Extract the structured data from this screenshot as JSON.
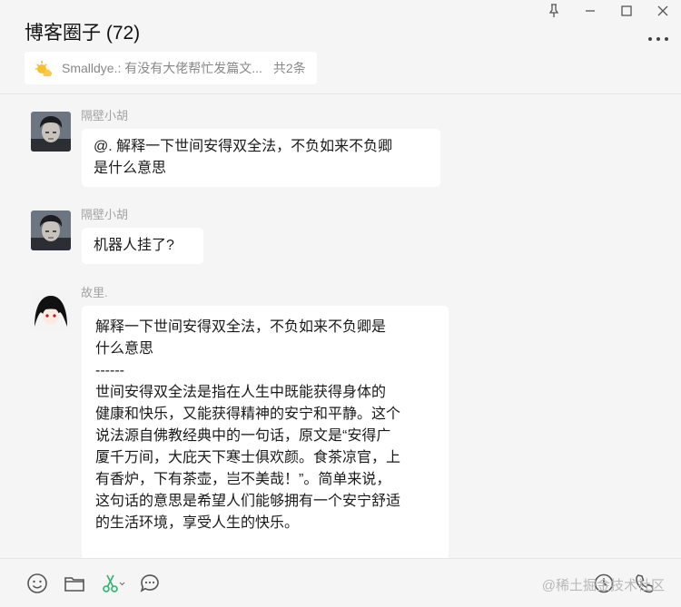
{
  "header": {
    "title": "博客圈子 (72)",
    "window_controls": [
      {
        "name": "pin-icon",
        "glyph": "⊥"
      },
      {
        "name": "minimize-icon",
        "glyph": "—"
      },
      {
        "name": "maximize-icon",
        "glyph": "☐"
      },
      {
        "name": "close-icon",
        "glyph": "✕"
      }
    ],
    "notice": {
      "icon": "notice-sun-icon",
      "text": "Smalldye.: 有没有大佬帮忙发篇文...",
      "count": "共2条"
    }
  },
  "messages": [
    {
      "sender": "隔壁小胡",
      "avatar": "avatar-dark-hair-man",
      "lines": [
        "@. 解释一下世间安得双全法，不负如来不负卿",
        "是什么意思"
      ]
    },
    {
      "sender": "隔壁小胡",
      "avatar": "avatar-dark-hair-man",
      "lines": [
        "机器人挂了?"
      ]
    },
    {
      "sender": "故里.",
      "avatar": "avatar-anime-girl",
      "lines": [
        " 解释一下世间安得双全法，不负如来不负卿是",
        "什么意思",
        " ------",
        " 世间安得双全法是指在人生中既能获得身体的",
        "健康和快乐，又能获得精神的安宁和平静。这个",
        "说法源自佛教经典中的一句话，原文是“安得广",
        "厦千万间，大庇天下寒士俱欢颜。食茶凉官，上",
        "有香炉，下有茶壶，岂不美哉！”。简单来说，",
        "这句话的意思是希望人们能够拥有一个安宁舒适",
        "的生活环境，享受人生的快乐。"
      ]
    }
  ],
  "toolbar": {
    "tools": [
      "emoji-icon",
      "folder-icon",
      "scissors-icon",
      "chat-bubble-icon",
      "history-icon",
      "phone-icon"
    ],
    "watermark": "@稀土掘金技术社区"
  },
  "colors": {
    "background": "#f5f5f5",
    "bubble": "#ffffff",
    "sender_name": "#a3a3a3",
    "scissors_green": "#2fb36b"
  }
}
